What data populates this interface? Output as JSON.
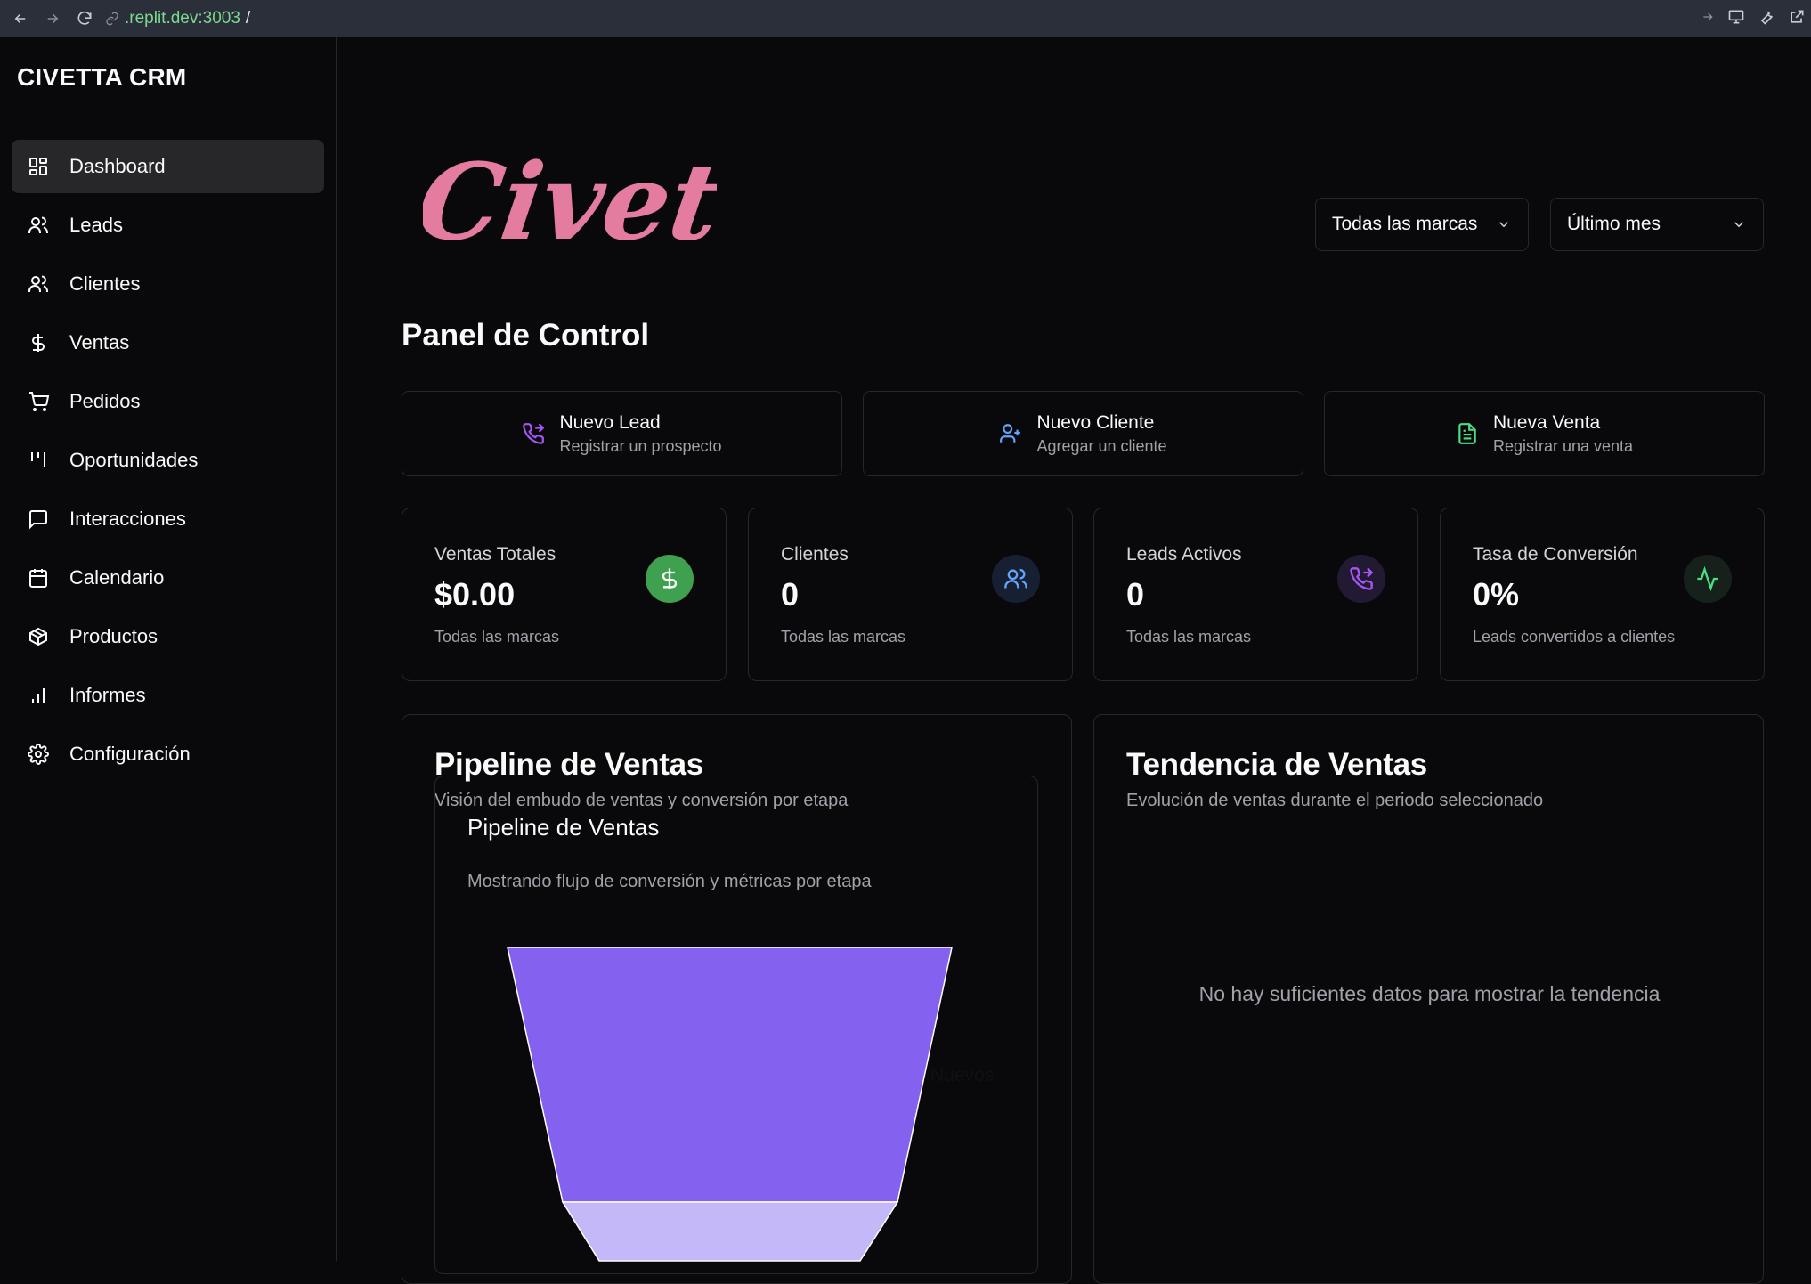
{
  "browser": {
    "url_host": ".replit.dev:3003",
    "url_path": "/"
  },
  "brand": "CIVETTA CRM",
  "nav": [
    {
      "label": "Dashboard",
      "icon": "dashboard-icon",
      "active": true
    },
    {
      "label": "Leads",
      "icon": "users-icon"
    },
    {
      "label": "Clientes",
      "icon": "users-icon"
    },
    {
      "label": "Ventas",
      "icon": "dollar-icon"
    },
    {
      "label": "Pedidos",
      "icon": "cart-icon"
    },
    {
      "label": "Oportunidades",
      "icon": "kanban-icon"
    },
    {
      "label": "Interacciones",
      "icon": "message-icon"
    },
    {
      "label": "Calendario",
      "icon": "calendar-icon"
    },
    {
      "label": "Productos",
      "icon": "package-icon"
    },
    {
      "label": "Informes",
      "icon": "bar-chart-icon"
    },
    {
      "label": "Configuración",
      "icon": "gear-icon"
    }
  ],
  "logo_text": "Civetta",
  "filters": {
    "brand": "Todas las marcas",
    "period": "Último mes"
  },
  "page_title": "Panel de Control",
  "quick_actions": [
    {
      "title": "Nuevo Lead",
      "subtitle": "Registrar un prospecto",
      "icon": "phone-forward-icon",
      "color": "#a855f7"
    },
    {
      "title": "Nuevo Cliente",
      "subtitle": "Agregar un cliente",
      "icon": "user-plus-icon",
      "color": "#60a5fa"
    },
    {
      "title": "Nueva Venta",
      "subtitle": "Registrar una venta",
      "icon": "file-text-icon",
      "color": "#4ade80"
    }
  ],
  "stats": [
    {
      "label": "Ventas Totales",
      "value": "$0.00",
      "sub": "Todas las marcas",
      "icon": "dollar-icon",
      "bg": "#3fa14f",
      "fg": "#ffffff"
    },
    {
      "label": "Clientes",
      "value": "0",
      "sub": "Todas las marcas",
      "icon": "users-icon",
      "bg": "#172033",
      "fg": "#60a5fa"
    },
    {
      "label": "Leads Activos",
      "value": "0",
      "sub": "Todas las marcas",
      "icon": "phone-forward-icon",
      "bg": "#221a33",
      "fg": "#a855f7"
    },
    {
      "label": "Tasa de Conversión",
      "value": "0%",
      "sub": "Leads convertidos a clientes",
      "icon": "activity-icon",
      "bg": "#15211a",
      "fg": "#4ade80"
    }
  ],
  "pipeline": {
    "title": "Pipeline de Ventas",
    "subtitle": "Visión del embudo de ventas y conversión por etapa",
    "inner_title": "Pipeline de Ventas",
    "inner_subtitle": "Mostrando flujo de conversión y métricas por etapa",
    "stage_label": "Nuevos"
  },
  "trend": {
    "title": "Tendencia de Ventas",
    "subtitle": "Evolución de ventas durante el periodo seleccionado",
    "empty": "No hay suficientes datos para mostrar la tendencia"
  }
}
